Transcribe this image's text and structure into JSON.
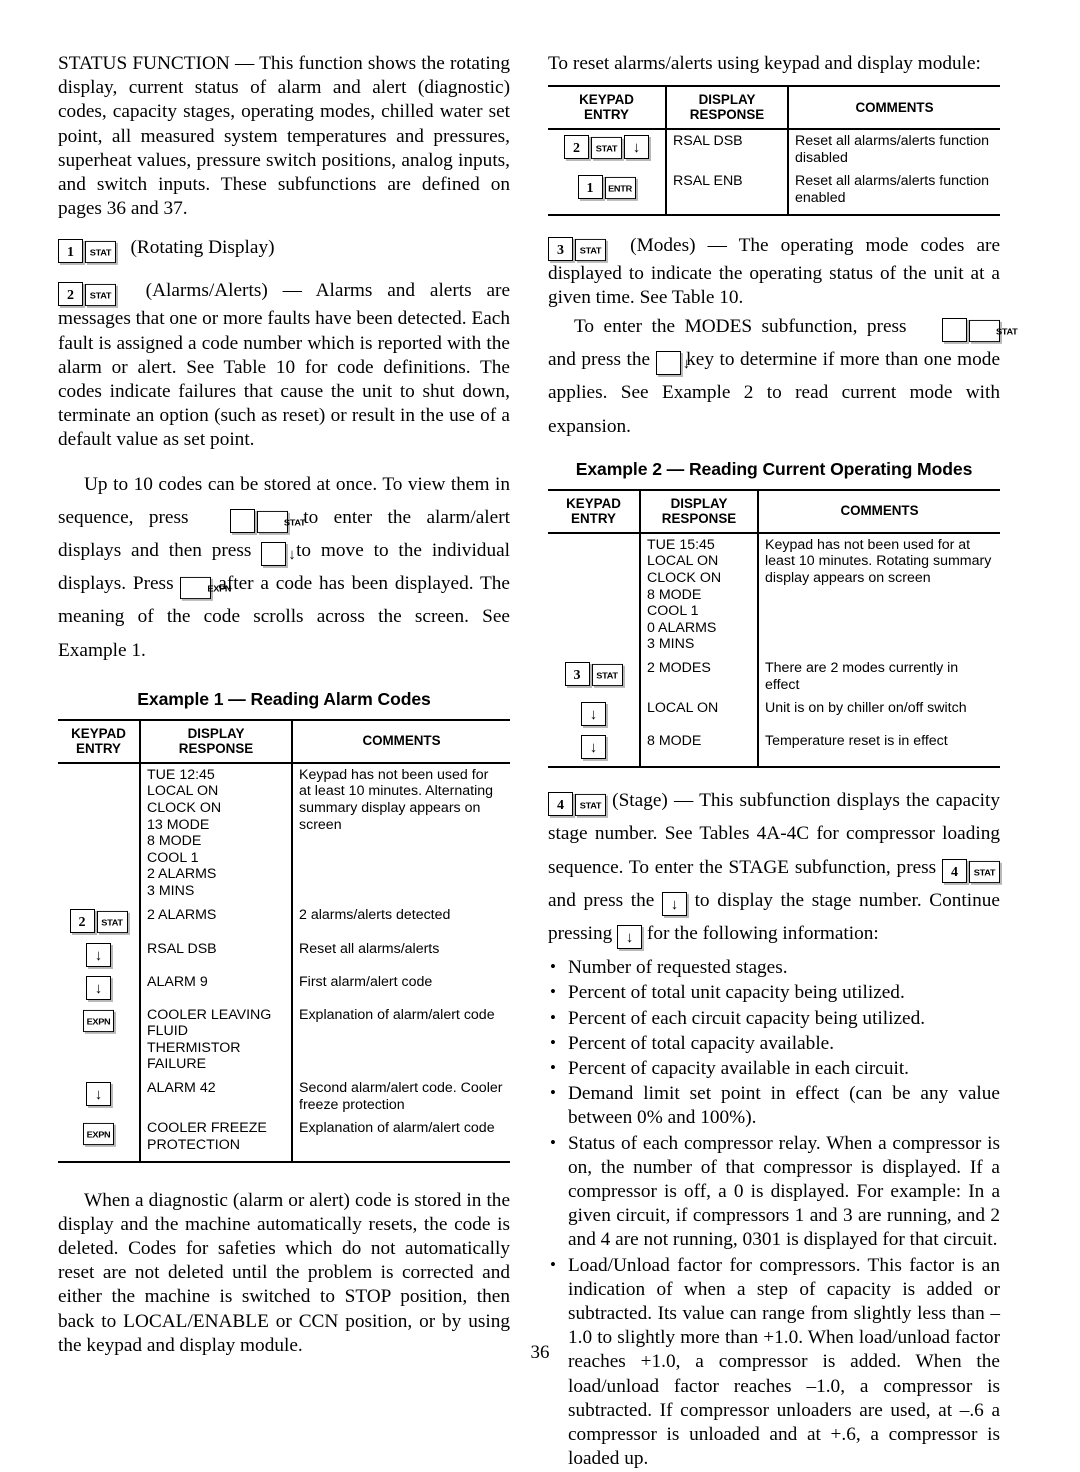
{
  "page": {
    "number": "36"
  },
  "keys": {
    "stat": "STAT",
    "entr": "ENTR",
    "expn": "EXPN",
    "down": "↓",
    "n1": "1",
    "n2": "2",
    "n3": "3",
    "n4": "4"
  },
  "left": {
    "status_function": "STATUS FUNCTION — This function shows the rotating display, current status of alarm and alert (diagnostic) codes, capacity stages, operating modes, chilled water set point, all measured system temperatures and pressures, superheat values, pressure switch positions, analog inputs, and switch inputs. These subfunctions are defined on pages 36 and 37.",
    "rotating_display_label": "(Rotating Display)",
    "alarms_alerts_text": "(Alarms/Alerts) — Alarms and alerts are messages that one or more faults have been detected. Each fault is assigned a code number which is reported with the alarm or alert. See Table 10 for code definitions. The codes indicate failures that cause the unit to shut down, terminate an option (such as reset) or result in the use of a default value as set point.",
    "view_codes_p1": "Up to 10 codes can be stored at once. To view them in sequence, press",
    "view_codes_p2": "to enter the alarm/alert displays and then press",
    "view_codes_p3": "to move to the individual displays. Press",
    "view_codes_p4": "after a code has been displayed. The meaning of the code scrolls across the screen. See Example 1.",
    "diagnostic_paragraph": "When a diagnostic (alarm or alert) code is stored in the display and the machine automatically resets, the code is deleted. Codes for safeties which do not automatically reset are not deleted until the problem is corrected and either the machine is switched to STOP position, then back to LOCAL/ENABLE or CCN position, or by using the keypad and display module."
  },
  "right": {
    "reset_intro": "To reset alarms/alerts using keypad and display module:",
    "modes_text": "(Modes) — The operating mode codes are displayed to indicate the operating status of the unit at a given time. See Table 10.",
    "modes_enter_p1": "To enter the MODES subfunction, press",
    "modes_enter_p2": "and press the",
    "modes_enter_p3": "key to determine if more than one mode applies. See Example 2 to read current mode with expansion.",
    "stage_p1": "(Stage) — This subfunction displays the capacity stage number. See Tables 4A-4C for compressor loading sequence. To enter the STAGE subfunction, press",
    "stage_p2": "and press the",
    "stage_p3": "to display the stage number. Continue pressing",
    "stage_p4": "for the following information:",
    "bullets": [
      "Number of requested stages.",
      "Percent of total unit capacity being utilized.",
      "Percent of each circuit capacity being utilized.",
      "Percent of total capacity available.",
      "Percent of capacity available in each circuit.",
      "Demand limit set point in effect (can be any value between 0% and 100%).",
      "Status of each compressor relay. When a compressor is on, the number of that compressor is displayed. If a compressor is off, a 0 is displayed. For example: In a given circuit, if compressors 1 and 3 are running, and 2 and 4 are not running, 0301 is displayed for that circuit.",
      "Load/Unload factor for compressors. This factor is an indication of when a step of capacity is added or subtracted. Its value can range from slightly less than –1.0 to slightly more than +1.0. When load/unload factor reaches +1.0, a compressor is added. When the load/unload factor reaches –1.0, a compressor is subtracted. If compressor unloaders are used, at –.6 a compressor is unloaded and at +.6, a compressor is loaded up."
    ]
  },
  "table_headers": {
    "keypad_entry": "KEYPAD\nENTRY",
    "display_response": "DISPLAY\nRESPONSE",
    "comments": "COMMENTS"
  },
  "reset_table": {
    "rows": [
      {
        "keys": [
          "n2",
          "stat",
          "down"
        ],
        "display": "RSAL DSB",
        "comment": "Reset all alarms/alerts function disabled"
      },
      {
        "keys": [
          "n1",
          "entr"
        ],
        "display": "RSAL ENB",
        "comment": "Reset all alarms/alerts function enabled"
      }
    ]
  },
  "example1": {
    "title": "Example 1 — Reading Alarm Codes",
    "rows": [
      {
        "keys": [],
        "display": "TUE 12:45\nLOCAL ON\nCLOCK ON\n13 MODE\n8 MODE\nCOOL 1\n2 ALARMS\n3 MINS",
        "comment": "Keypad has not been used for at least 10 minutes. Alternating summary display appears on screen"
      },
      {
        "keys": [
          "n2",
          "stat"
        ],
        "display": "2 ALARMS",
        "comment": "2 alarms/alerts detected"
      },
      {
        "keys": [
          "down"
        ],
        "display": "RSAL DSB",
        "comment": "Reset all alarms/alerts"
      },
      {
        "keys": [
          "down"
        ],
        "display": "ALARM 9",
        "comment": "First alarm/alert code"
      },
      {
        "keys": [
          "expn"
        ],
        "display": "COOLER LEAVING\nFLUID THERMISTOR\nFAILURE",
        "comment": "Explanation of alarm/alert code"
      },
      {
        "keys": [
          "down"
        ],
        "display": "ALARM 42",
        "comment": "Second alarm/alert code. Cooler freeze protection"
      },
      {
        "keys": [
          "expn"
        ],
        "display": "COOLER FREEZE\nPROTECTION",
        "comment": "Explanation of alarm/alert code"
      }
    ]
  },
  "example2": {
    "title": "Example 2 — Reading Current Operating Modes",
    "rows": [
      {
        "keys": [],
        "display": "TUE 15:45\nLOCAL ON\nCLOCK ON\n8 MODE\nCOOL 1\n0 ALARMS\n3 MINS",
        "comment": "Keypad has not been used for at least 10 minutes. Rotating summary display appears on screen"
      },
      {
        "keys": [
          "n3",
          "stat"
        ],
        "display": "2 MODES",
        "comment": "There are 2 modes currently in effect"
      },
      {
        "keys": [
          "down"
        ],
        "display": "LOCAL ON",
        "comment": "Unit is on by chiller on/off switch"
      },
      {
        "keys": [
          "down"
        ],
        "display": "8 MODE",
        "comment": "Temperature reset is in effect"
      }
    ]
  }
}
